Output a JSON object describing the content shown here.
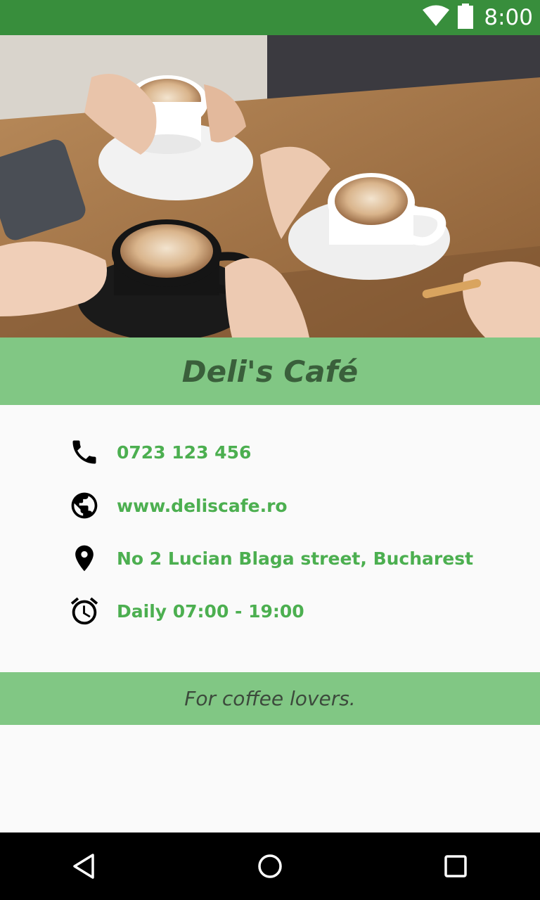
{
  "status_bar": {
    "time": "8:00",
    "icons": [
      "wifi-icon",
      "battery-icon"
    ],
    "color": "#388e3c"
  },
  "hero_image": {
    "description_icon": "coffee-photo"
  },
  "cafe": {
    "title": "Deli's Café",
    "tagline": "For coffee lovers."
  },
  "contact": {
    "phone": "0723 123 456",
    "website": "www.deliscafe.ro",
    "address": "No 2 Lucian Blaga street, Bucharest",
    "hours": "Daily 07:00 - 19:00"
  },
  "icons": {
    "phone": "phone-icon",
    "website": "globe-icon",
    "address": "location-pin-icon",
    "hours": "alarm-clock-icon"
  },
  "nav_bar": {
    "buttons": [
      "back-button",
      "home-button",
      "recents-button"
    ]
  },
  "colors": {
    "accent_green": "#4caf50",
    "light_green": "#81c784",
    "dark_green": "#388e3c",
    "title_text": "#3a5f3b"
  }
}
